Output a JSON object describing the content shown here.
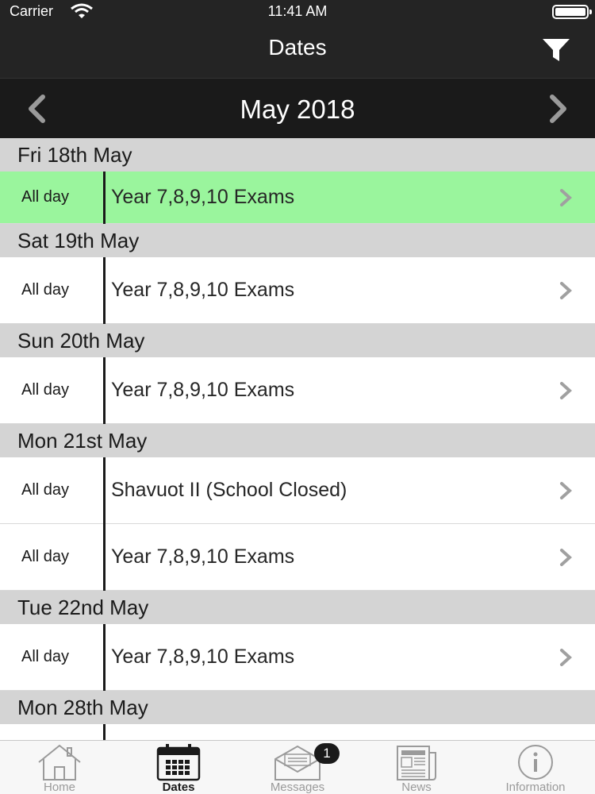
{
  "status": {
    "carrier": "Carrier",
    "time": "11:41 AM"
  },
  "header": {
    "title": "Dates"
  },
  "month": {
    "label": "May 2018"
  },
  "sections": [
    {
      "date": "Fri 18th May",
      "events": [
        {
          "time": "All day",
          "title": "Year 7,8,9,10 Exams",
          "highlight": true
        }
      ]
    },
    {
      "date": "Sat 19th May",
      "events": [
        {
          "time": "All day",
          "title": "Year 7,8,9,10 Exams"
        }
      ]
    },
    {
      "date": "Sun 20th May",
      "events": [
        {
          "time": "All day",
          "title": "Year 7,8,9,10 Exams"
        }
      ]
    },
    {
      "date": "Mon 21st May",
      "events": [
        {
          "time": "All day",
          "title": "Shavuot II (School Closed)"
        },
        {
          "time": "All day",
          "title": "Year 7,8,9,10 Exams"
        }
      ]
    },
    {
      "date": "Tue 22nd May",
      "events": [
        {
          "time": "All day",
          "title": "Year 7,8,9,10 Exams"
        }
      ]
    },
    {
      "date": "Mon 28th May",
      "events": []
    }
  ],
  "tabs": [
    {
      "label": "Home",
      "icon": "home-icon"
    },
    {
      "label": "Dates",
      "icon": "calendar-icon",
      "active": true
    },
    {
      "label": "Messages",
      "icon": "envelope-icon",
      "badge": "1"
    },
    {
      "label": "News",
      "icon": "newspaper-icon"
    },
    {
      "label": "Information",
      "icon": "info-icon"
    }
  ],
  "colors": {
    "bar": "#242424",
    "highlight": "#9af59d",
    "section": "#d4d4d4"
  }
}
